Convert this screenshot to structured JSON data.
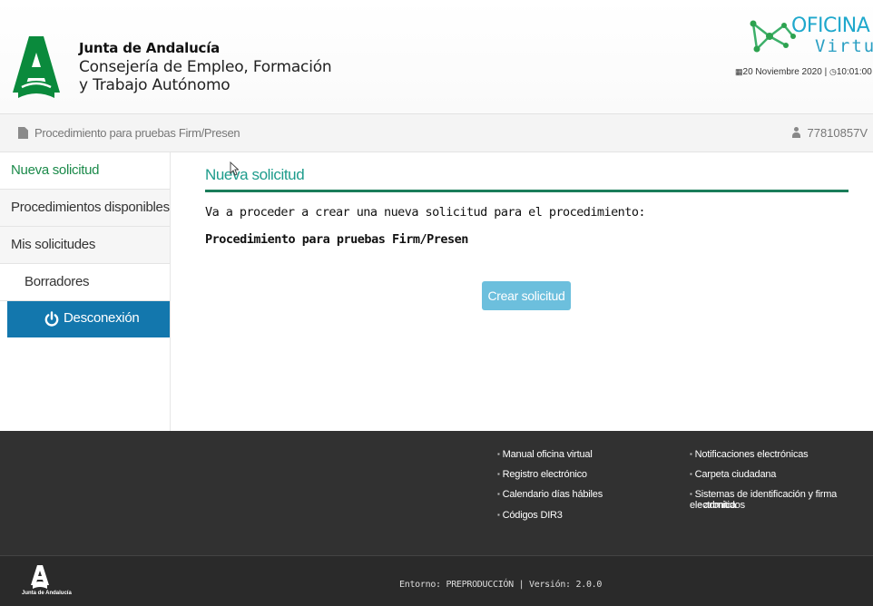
{
  "header": {
    "org_title": "Junta de Andalucía",
    "org_sub_line1": "Consejería de Empleo, Formación",
    "org_sub_line2": "y Trabajo Autónomo",
    "brand_word1": "OFICINA",
    "brand_word2": "Virtual",
    "date": "20 Noviembre 2020",
    "time": "10:01:00",
    "date_separator": "|"
  },
  "breadcrumb": {
    "text": "Procedimiento para pruebas Firm/Presen",
    "user_id": "77810857V"
  },
  "sidebar": {
    "items": [
      {
        "label": "Nueva solicitud"
      },
      {
        "label": "Procedimientos disponibles"
      },
      {
        "label": "Mis solicitudes"
      },
      {
        "label": "Borradores"
      }
    ],
    "logout_label": "Desconexión"
  },
  "main": {
    "title": "Nueva solicitud",
    "intro": "Va a proceder a crear una nueva solicitud para el procedimiento:",
    "procedure_name": "Procedimiento para pruebas Firm/Presen",
    "create_button": "Crear solicitud"
  },
  "footer": {
    "links_col1": [
      "Manual oficina virtual",
      "Registro electrónico",
      "Calendario días hábiles",
      "Códigos DIR3"
    ],
    "links_col2": [
      "Notificaciones electrónicas",
      "Carpeta ciudadana",
      "Sistemas de identificación y firma electronica",
      "admitidos"
    ],
    "logo_text": "Junta de Andalucía",
    "env_line": "Entorno: PREPRODUCCIÓN | Versión: 2.0.0"
  },
  "colors": {
    "brand_green": "#1b8a4a",
    "title_teal": "#1e9c8c",
    "logout_blue": "#1377ad",
    "create_button_blue": "#6cbfdd",
    "footer_bg": "#313131"
  }
}
